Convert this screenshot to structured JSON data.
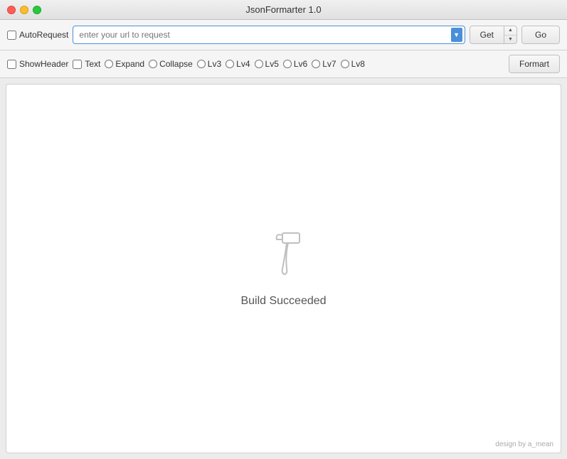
{
  "window": {
    "title": "JsonFormarter 1.0"
  },
  "toolbar": {
    "autorequest_label": "AutoRequest",
    "url_placeholder": "enter your url to request",
    "method_label": "Get",
    "go_label": "Go",
    "show_header_label": "ShowHeader",
    "text_label": "Text",
    "expand_label": "Expand",
    "collapse_label": "Collapse",
    "lv3_label": "Lv3",
    "lv4_label": "Lv4",
    "lv5_label": "Lv5",
    "lv6_label": "Lv6",
    "lv7_label": "Lv7",
    "lv8_label": "Lv8",
    "format_label": "Formart"
  },
  "content": {
    "build_text": "Build Succeeded"
  },
  "footer": {
    "credit": "design by a_mean"
  },
  "icons": {
    "hammer": "hammer-icon",
    "dropdown_arrow": "▼",
    "stepper_up": "▲",
    "stepper_down": "▼"
  }
}
